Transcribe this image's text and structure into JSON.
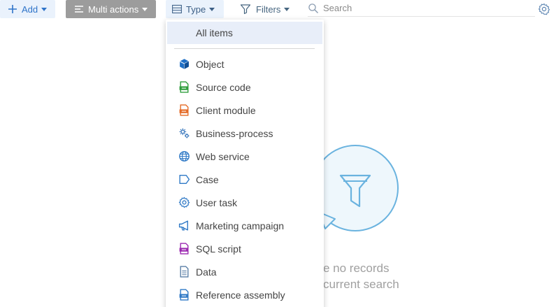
{
  "toolbar": {
    "add_label": "Add",
    "multi_actions_label": "Multi actions",
    "type_label": "Type",
    "filters_label": "Filters",
    "search_placeholder": "Search"
  },
  "empty_state": {
    "line1": "e no records",
    "line2": "current search"
  },
  "type_menu": {
    "all_items_label": "All items",
    "items": [
      {
        "label": "Object",
        "icon": "cube-icon",
        "color": "#1f6fc6"
      },
      {
        "label": "Source code",
        "icon": "source-code-icon",
        "color": "#2e9d3b"
      },
      {
        "label": "Client module",
        "icon": "client-module-icon",
        "color": "#e46a25"
      },
      {
        "label": "Business-process",
        "icon": "business-process-icon",
        "color": "#3a78bd"
      },
      {
        "label": "Web service",
        "icon": "globe-icon",
        "color": "#2f79c6"
      },
      {
        "label": "Case",
        "icon": "case-icon",
        "color": "#2f79c6"
      },
      {
        "label": "User task",
        "icon": "gear-icon",
        "color": "#2f79c6"
      },
      {
        "label": "Marketing campaign",
        "icon": "megaphone-icon",
        "color": "#2f79c6"
      },
      {
        "label": "SQL script",
        "icon": "sql-script-icon",
        "color": "#9b27b0"
      },
      {
        "label": "Data",
        "icon": "document-icon",
        "color": "#5a7fa6"
      },
      {
        "label": "Reference assembly",
        "icon": "assembly-icon",
        "color": "#2f79c6"
      }
    ]
  },
  "colors": {
    "accent": "#2f74c9",
    "selected_bg": "#e8eef9",
    "multi_actions_bg": "#9c9c9c",
    "empty_state_blue": "#6ab3df"
  }
}
